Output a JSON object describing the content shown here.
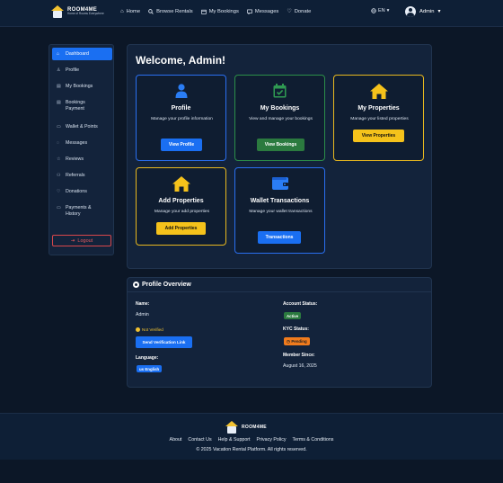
{
  "header": {
    "logo_name": "ROOM4ME",
    "logo_tagline": "Home of Rooms Everywhere",
    "nav": [
      {
        "label": "Home",
        "icon": "home-icon"
      },
      {
        "label": "Browse Rentals",
        "icon": "search-icon"
      },
      {
        "label": "My Bookings",
        "icon": "calendar-icon"
      },
      {
        "label": "Messages",
        "icon": "messages-icon"
      },
      {
        "label": "Donate",
        "icon": "heart-icon"
      }
    ],
    "language": "EN",
    "user_name": "Admin"
  },
  "sidebar": {
    "items": [
      {
        "label": "Dashboard",
        "icon": "dashboard-icon",
        "active": true
      },
      {
        "label": "Profile",
        "icon": "user-icon"
      },
      {
        "label": "My Bookings",
        "icon": "calendar-icon"
      },
      {
        "label": "Bookings Payment",
        "icon": "calendar-check-icon"
      },
      {
        "label": "Wallet & Points",
        "icon": "wallet-icon"
      },
      {
        "label": "Messages",
        "icon": "messages-icon"
      },
      {
        "label": "Reviews",
        "icon": "star-icon"
      },
      {
        "label": "Referrals",
        "icon": "users-icon"
      },
      {
        "label": "Donations",
        "icon": "heart-icon"
      },
      {
        "label": "Payments & History",
        "icon": "card-icon"
      }
    ],
    "logout_label": "Logout"
  },
  "main": {
    "welcome": "Welcome, Admin!",
    "cards": [
      {
        "title": "Profile",
        "desc": "Manage your profile information",
        "button": "View Profile",
        "color": "blue",
        "icon": "person-icon"
      },
      {
        "title": "My Bookings",
        "desc": "View and manage your bookings",
        "button": "View Bookings",
        "color": "green",
        "icon": "calendar-check-icon"
      },
      {
        "title": "My Properties",
        "desc": "Manage your listed properties",
        "button": "View Properties",
        "color": "yellow",
        "icon": "house-icon"
      },
      {
        "title": "Add Properties",
        "desc": "Manage your add properties",
        "button": "Add Properties",
        "color": "yellow",
        "icon": "house-icon"
      },
      {
        "title": "Wallet Transactions",
        "desc": "Manage your wallet transactions",
        "button": "Transactions",
        "color": "blue",
        "icon": "wallet-icon"
      }
    ]
  },
  "overview": {
    "title": "Profile Overview",
    "name_label": "Name:",
    "name_value": "Admin",
    "not_verified": "Not Verified",
    "send_verification": "Send Verification Link",
    "language_label": "Language:",
    "language_value": "us English",
    "account_status_label": "Account Status:",
    "account_status_value": "Active",
    "kyc_label": "KYC Status:",
    "kyc_value": "Pending",
    "member_since_label": "Member Since:",
    "member_since_value": "August 16, 2025"
  },
  "footer": {
    "logo_name": "ROOM4ME",
    "links": [
      "About",
      "Contact Us",
      "Help & Support",
      "Privacy Policy",
      "Terms & Conditions"
    ],
    "copyright": "© 2025 Vacation Rental Platform. All rights reserved."
  },
  "colors": {
    "background": "#0c1727",
    "panel": "#13233b",
    "primary": "#1a6ff2",
    "success": "#2b7a3f",
    "warning": "#f5c21b",
    "danger": "#d9474b"
  }
}
